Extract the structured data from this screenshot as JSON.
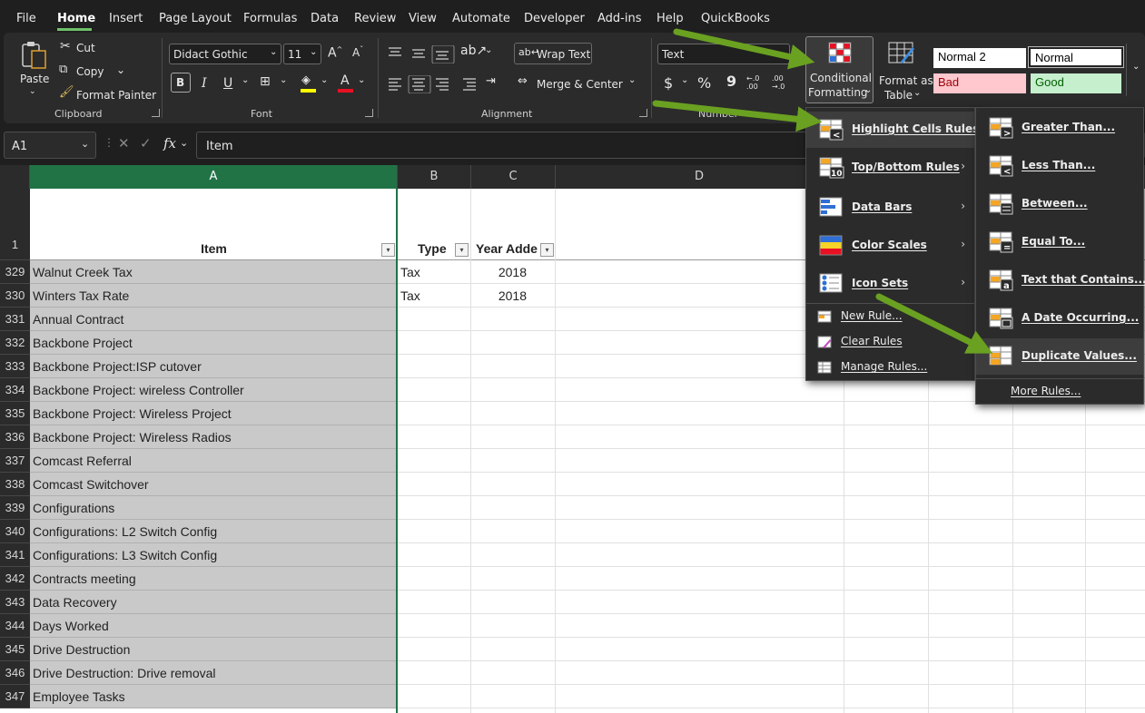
{
  "menubar": {
    "tabs": [
      "File",
      "Home",
      "Insert",
      "Page Layout",
      "Formulas",
      "Data",
      "Review",
      "View",
      "Automate",
      "Developer",
      "Add-ins",
      "Help",
      "QuickBooks"
    ],
    "active": "Home"
  },
  "ribbon": {
    "clipboard": {
      "paste": "Paste",
      "cut": "Cut",
      "copy": "Copy",
      "format_painter": "Format Painter",
      "label": "Clipboard"
    },
    "font": {
      "name": "Didact Gothic",
      "size": "11",
      "grow": "A",
      "shrink": "A",
      "bold": "B",
      "italic": "I",
      "underline": "U",
      "label": "Font",
      "fill_color": "#ffff00",
      "font_color": "#e81123"
    },
    "alignment": {
      "wrap_text": "Wrap Text",
      "merge_center": "Merge & Center",
      "label": "Alignment"
    },
    "number": {
      "format": "Text",
      "dollar": "$",
      "percent": "%",
      "comma": "9",
      "inc_decimal": "←.0 .00",
      "dec_decimal": ".00 →.0",
      "label": "Number"
    },
    "styles": {
      "conditional_formatting": [
        "Conditional",
        "Formatting"
      ],
      "format_as_table": [
        "Format as",
        "Table"
      ],
      "cells": [
        {
          "label": "Normal 2",
          "bg": "#ffffff",
          "fg": "#000000"
        },
        {
          "label": "Normal",
          "bg": "#ffffff",
          "fg": "#000000"
        },
        {
          "label": "Bad",
          "bg": "#ffc7ce",
          "fg": "#9c0006"
        },
        {
          "label": "Good",
          "bg": "#c6efce",
          "fg": "#006100"
        }
      ]
    }
  },
  "formula_bar": {
    "name_box": "A1",
    "fx": "fx",
    "content": "Item"
  },
  "grid": {
    "columns": [
      "A",
      "B",
      "C",
      "D"
    ],
    "header_row": {
      "number": "1",
      "A": "Item",
      "B": "Type",
      "C": "Year Adde"
    },
    "rows": [
      {
        "n": "329",
        "a": "Walnut Creek Tax",
        "b": "Tax",
        "c": "2018"
      },
      {
        "n": "330",
        "a": "Winters Tax Rate",
        "b": "Tax",
        "c": "2018"
      },
      {
        "n": "331",
        "a": "Annual Contract",
        "b": "",
        "c": ""
      },
      {
        "n": "332",
        "a": "Backbone Project",
        "b": "",
        "c": ""
      },
      {
        "n": "333",
        "a": "Backbone Project:ISP cutover",
        "b": "",
        "c": ""
      },
      {
        "n": "334",
        "a": "Backbone Project: wireless Controller",
        "b": "",
        "c": ""
      },
      {
        "n": "335",
        "a": "Backbone Project: Wireless Project",
        "b": "",
        "c": ""
      },
      {
        "n": "336",
        "a": "Backbone Project: Wireless Radios",
        "b": "",
        "c": ""
      },
      {
        "n": "337",
        "a": "Comcast Referral",
        "b": "",
        "c": ""
      },
      {
        "n": "338",
        "a": "Comcast Switchover",
        "b": "",
        "c": ""
      },
      {
        "n": "339",
        "a": "Configurations",
        "b": "",
        "c": ""
      },
      {
        "n": "340",
        "a": "Configurations: L2 Switch Config",
        "b": "",
        "c": ""
      },
      {
        "n": "341",
        "a": "Configurations: L3 Switch Config",
        "b": "",
        "c": ""
      },
      {
        "n": "342",
        "a": "Contracts meeting",
        "b": "",
        "c": ""
      },
      {
        "n": "343",
        "a": "Data Recovery",
        "b": "",
        "c": ""
      },
      {
        "n": "344",
        "a": "Days Worked",
        "b": "",
        "c": ""
      },
      {
        "n": "345",
        "a": "Drive Destruction",
        "b": "",
        "c": ""
      },
      {
        "n": "346",
        "a": "Drive Destruction: Drive removal",
        "b": "",
        "c": ""
      },
      {
        "n": "347",
        "a": "Employee Tasks",
        "b": "",
        "c": ""
      }
    ]
  },
  "cf_menu": {
    "items": [
      "Highlight Cells Rules",
      "Top/Bottom Rules",
      "Data Bars",
      "Color Scales",
      "Icon Sets"
    ],
    "small_items": [
      "New Rule...",
      "Clear Rules",
      "Manage Rules..."
    ]
  },
  "highlight_submenu": {
    "items": [
      "Greater Than...",
      "Less Than...",
      "Between...",
      "Equal To...",
      "Text that Contains...",
      "A Date Occurring...",
      "Duplicate Values..."
    ],
    "more": "More Rules..."
  },
  "accent": {
    "excel_green": "#217346",
    "arrow_green": "#6aa121"
  }
}
